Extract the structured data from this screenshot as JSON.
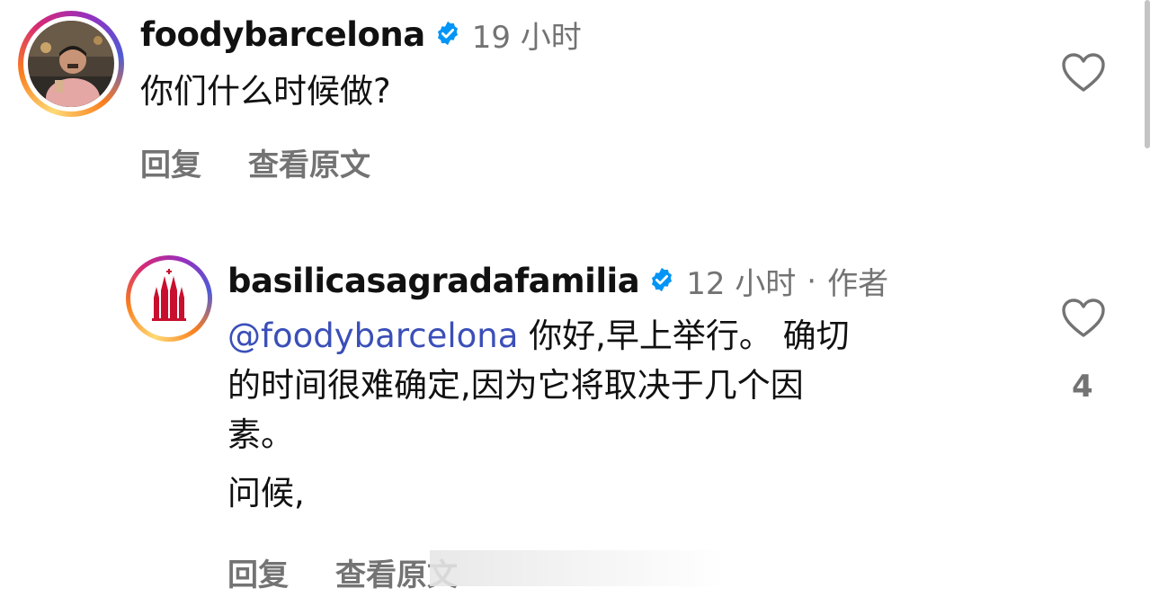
{
  "comments": [
    {
      "username": "foodybarcelona",
      "time": "19 小时",
      "author_tag": "",
      "text": "你们什么时候做?",
      "reply_label": "回复",
      "translate_label": "查看原文",
      "likes": ""
    },
    {
      "username": "basilicasagradafamilia",
      "time": "12 小时",
      "separator": "·",
      "author_tag": "作者",
      "mention": "@foodybarcelona",
      "text_line1": " 你好,早上举行。 确切",
      "text_line2": "的时间很难确定,因为它将取决于几个因",
      "text_line3": "素。",
      "text_line4": "问候,",
      "reply_label": "回复",
      "translate_label": "查看原文",
      "likes": "4"
    }
  ],
  "icons": {
    "verified": "verified-badge-icon",
    "heart": "heart-outline-icon"
  },
  "colors": {
    "verified_blue": "#0095f6",
    "mention": "#3b4fb8",
    "secondary_text": "#737373",
    "sagrada_red": "#c8102e"
  }
}
